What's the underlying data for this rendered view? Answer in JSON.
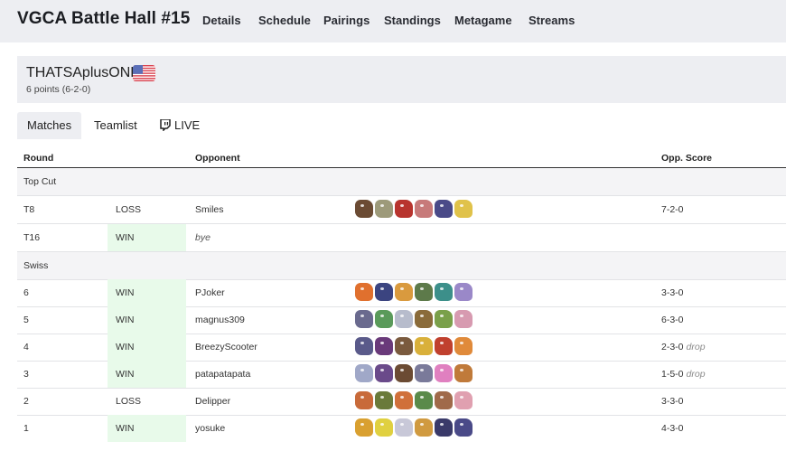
{
  "site": {
    "title": "VGCA Battle Hall #15",
    "nav": [
      "Details",
      "Schedule",
      "Pairings",
      "Standings",
      "Metagame",
      "Streams"
    ]
  },
  "player": {
    "name": "THATSAplusONE",
    "flag": "us-flag-icon",
    "record": "6 points (6-2-0)"
  },
  "tabs": {
    "matches": "Matches",
    "teamlist": "Teamlist",
    "live": "LIVE",
    "live_icon": "twitch-icon"
  },
  "table": {
    "headers": {
      "round": "Round",
      "opponent": "Opponent",
      "score": "Opp. Score"
    },
    "sections": {
      "top_cut": "Top Cut",
      "swiss": "Swiss"
    },
    "rows": [
      {
        "round": "T8",
        "result": "LOSS",
        "opponent": "Smiles",
        "score": "7-2-0",
        "drop": "",
        "team": [
          "#6b4b33",
          "#9d9a7a",
          "#b8342e",
          "#c77a7a",
          "#4a4a88",
          "#e0c24a"
        ]
      },
      {
        "round": "T16",
        "result": "WIN",
        "opponent": "bye",
        "score": "",
        "drop": "",
        "team": []
      },
      {
        "round": "6",
        "result": "WIN",
        "opponent": "PJoker",
        "score": "3-3-0",
        "drop": "",
        "team": [
          "#e0702e",
          "#3b4480",
          "#d99a3e",
          "#5d7a4a",
          "#3c8f8a",
          "#9a88c8"
        ]
      },
      {
        "round": "5",
        "result": "WIN",
        "opponent": "magnus309",
        "score": "6-3-0",
        "drop": "",
        "team": [
          "#6a6a8e",
          "#5a9a5a",
          "#b7bccc",
          "#8a6b3a",
          "#7aa04a",
          "#d79ab0"
        ]
      },
      {
        "round": "4",
        "result": "WIN",
        "opponent": "BreezyScooter",
        "score": "2-3-0",
        "drop": "drop",
        "team": [
          "#5a5a8a",
          "#6a3a7a",
          "#7a5a3e",
          "#d9b03a",
          "#c0402e",
          "#e08a3a"
        ]
      },
      {
        "round": "3",
        "result": "WIN",
        "opponent": "patapatapata",
        "score": "1-5-0",
        "drop": "drop",
        "team": [
          "#a0a8c8",
          "#6a4a8a",
          "#6b4b33",
          "#7a7a9a",
          "#e080c0",
          "#c07a3a"
        ]
      },
      {
        "round": "2",
        "result": "LOSS",
        "opponent": "Delipper",
        "score": "3-3-0",
        "drop": "",
        "team": [
          "#c86a3a",
          "#6a7a3a",
          "#d0703a",
          "#5a8a4a",
          "#a06a4a",
          "#e0a0b0"
        ]
      },
      {
        "round": "1",
        "result": "WIN",
        "opponent": "yosuke",
        "score": "4-3-0",
        "drop": "",
        "team": [
          "#d9a030",
          "#e0d040",
          "#c8c8d8",
          "#d09a40",
          "#3a3a6a",
          "#4a4a88"
        ]
      }
    ]
  },
  "colors": {
    "nav_bg": "#edeef2",
    "win_bg": "#e8faea"
  }
}
